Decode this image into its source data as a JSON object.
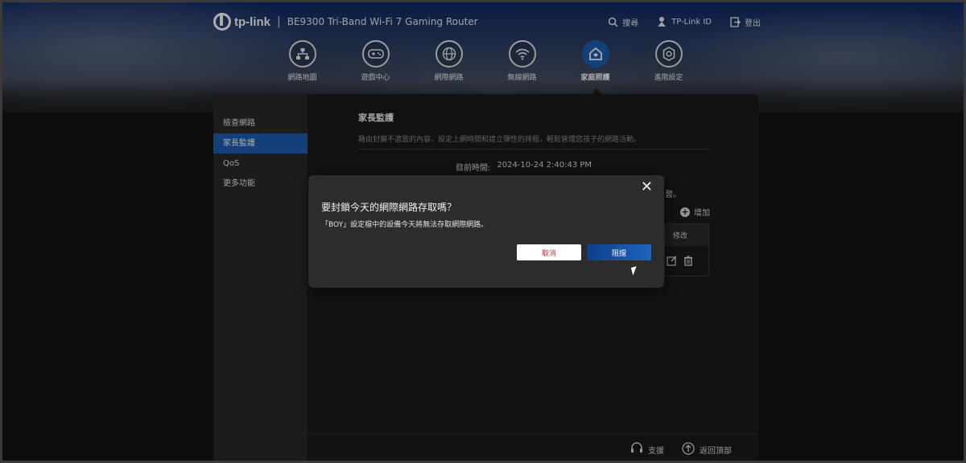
{
  "brand": {
    "logo_text": "tp-link",
    "separator": "|",
    "model": "BE9300 Tri-Band Wi-Fi 7 Gaming Router"
  },
  "top_actions": [
    {
      "label": "搜尋",
      "icon": "search-icon"
    },
    {
      "label": "TP-Link ID",
      "icon": "tplink-id-icon"
    },
    {
      "label": "登出",
      "icon": "logout-icon"
    }
  ],
  "nav": [
    {
      "label": "網路地圖",
      "icon": "network-map-icon",
      "active": false
    },
    {
      "label": "遊戲中心",
      "icon": "gamepad-icon",
      "active": false
    },
    {
      "label": "網際網路",
      "icon": "globe-icon",
      "active": false
    },
    {
      "label": "無線網路",
      "icon": "wifi-icon",
      "active": false
    },
    {
      "label": "家庭照護",
      "icon": "home-shield-icon",
      "active": true
    },
    {
      "label": "進階設定",
      "icon": "gear-icon",
      "active": false
    }
  ],
  "sidebar": {
    "items": [
      {
        "label": "檢查網路",
        "active": false
      },
      {
        "label": "家長監護",
        "active": true
      },
      {
        "label": "QoS",
        "active": false
      },
      {
        "label": "更多功能",
        "active": false
      }
    ]
  },
  "content": {
    "title": "家長監護",
    "description": "藉由封鎖不適當的內容、設定上網時間和建立彈性的排程，輕鬆管理您孩子的網路活動。",
    "time_label": "目前時間:",
    "time_value": "2024-10-24 2:40:43 PM",
    "partial_text": "習。",
    "add_label": "增加",
    "table_header": "修改"
  },
  "footer": {
    "support": "支援",
    "back_to_top": "返回頂部"
  },
  "modal": {
    "title": "要封鎖今天的網際網路存取嗎？",
    "message": "「BOY」設定檔中的設備今天將無法存取網際網路。",
    "cancel_label": "取消",
    "block_label": "阻擋"
  },
  "colors": {
    "accent": "#1e5fb4",
    "cancel_text": "#c23b3b",
    "modal_bg": "#2c2c2c",
    "sidebar_bg": "#2a2a2a"
  }
}
